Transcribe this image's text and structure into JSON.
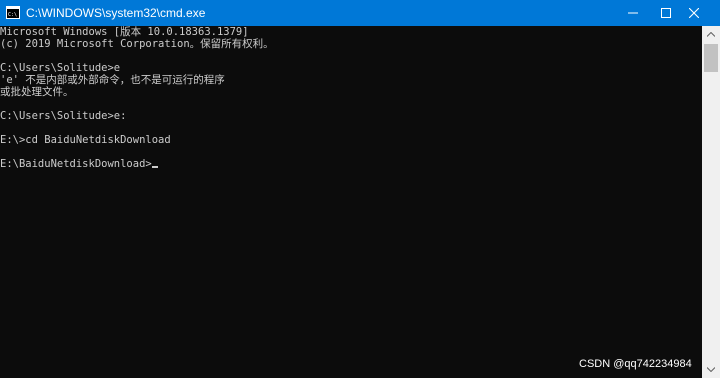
{
  "window": {
    "title": "C:\\WINDOWS\\system32\\cmd.exe",
    "icon": "cmd-prompt-icon",
    "controls": {
      "minimize_icon": "minimize-icon",
      "maximize_icon": "maximize-icon",
      "close_icon": "close-icon"
    },
    "colors": {
      "titlebar": "#0078d7",
      "console_bg": "#0c0c0c",
      "console_text": "#cccccc"
    }
  },
  "console": {
    "lines": [
      "Microsoft Windows [版本 10.0.18363.1379]",
      "(c) 2019 Microsoft Corporation。保留所有权利。",
      "",
      "C:\\Users\\Solitude>e",
      "'e' 不是内部或外部命令，也不是可运行的程序",
      "或批处理文件。",
      "",
      "C:\\Users\\Solitude>e:",
      "",
      "E:\\>cd BaiduNetdiskDownload",
      "",
      "E:\\BaiduNetdiskDownload>"
    ]
  },
  "watermark": "CSDN @qq742234984"
}
